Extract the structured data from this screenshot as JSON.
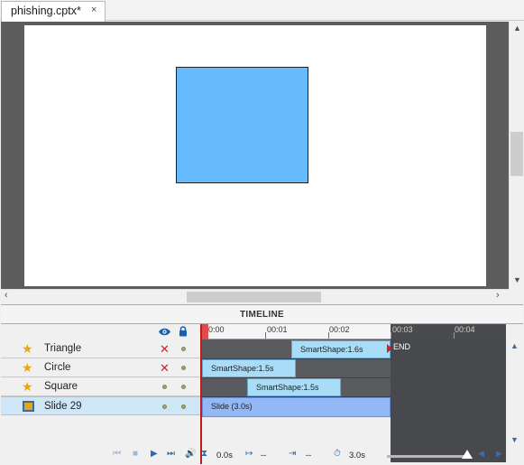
{
  "document": {
    "tab_label": "phishing.cptx*",
    "close_glyph": "×"
  },
  "stage": {
    "slide_bg": "#ffffff",
    "shape_fill": "#66bbff"
  },
  "scroll": {
    "up": "▲",
    "down": "▼",
    "left": "‹",
    "right": "›"
  },
  "timeline": {
    "title": "TIMELINE",
    "eye_icon": "eye-icon",
    "lock_icon": "lock-icon",
    "ruler_labels": [
      "00:00",
      "00:01",
      "00:02",
      "00:03",
      "00:04"
    ],
    "end_label": "END",
    "layers": [
      {
        "name": "Triangle",
        "icon": "star-icon",
        "visibility": "hidden"
      },
      {
        "name": "Circle",
        "icon": "star-icon",
        "visibility": "hidden"
      },
      {
        "name": "Square",
        "icon": "star-icon",
        "visibility": "visible"
      },
      {
        "name": "Slide 29",
        "icon": "slide-icon",
        "visibility": "visible",
        "selected": true
      }
    ],
    "bars": [
      {
        "label": "SmartShape:1.6s"
      },
      {
        "label": "SmartShape:1.5s"
      },
      {
        "label": "SmartShape:1.5s"
      },
      {
        "label": "Slide (3.0s)"
      }
    ],
    "hidden_mark": "✕",
    "controls": {
      "current_time": "0.0s",
      "start_time": "--",
      "duration": "--",
      "slide_duration": "3.0s"
    }
  }
}
